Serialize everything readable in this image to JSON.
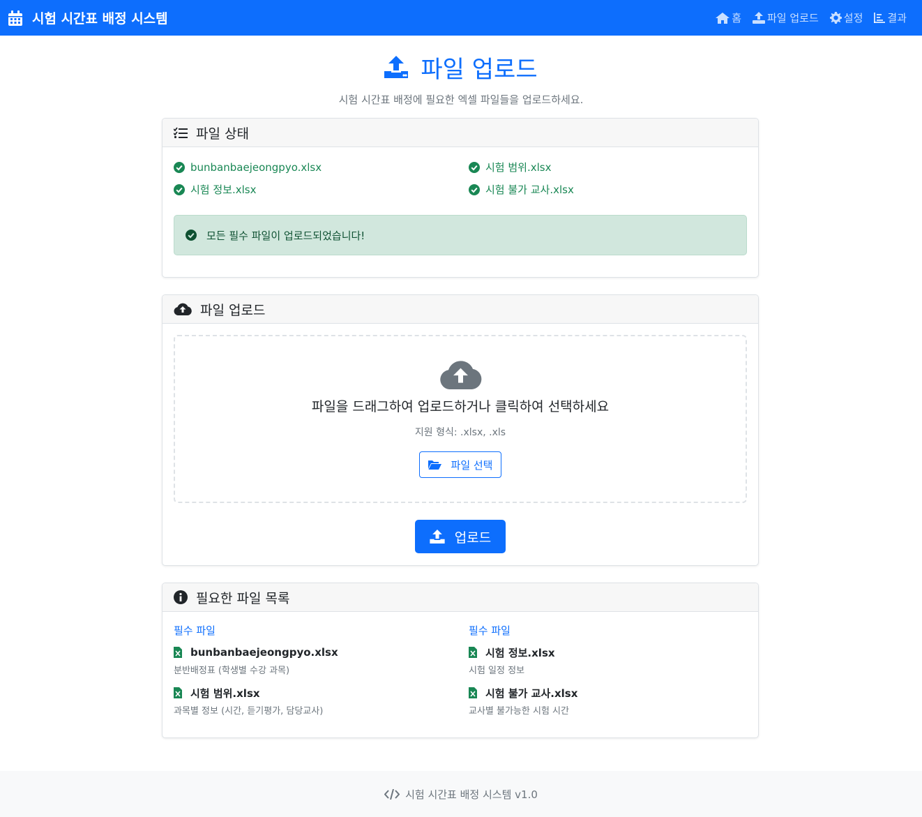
{
  "navbar": {
    "brand": "시험 시간표 배정 시스템",
    "links": [
      {
        "label": "홈",
        "icon": "home-icon"
      },
      {
        "label": "파일 업로드",
        "icon": "upload-icon"
      },
      {
        "label": "설정",
        "icon": "gear-icon"
      },
      {
        "label": "결과",
        "icon": "chart-icon"
      }
    ]
  },
  "header": {
    "title": "파일 업로드",
    "subtitle": "시험 시간표 배정에 필요한 엑셀 파일들을 업로드하세요."
  },
  "status_card": {
    "title": "파일 상태",
    "files": [
      "bunbanbaejeongpyo.xlsx",
      "시험 범위.xlsx",
      "시험 정보.xlsx",
      "시험 불가 교사.xlsx"
    ],
    "alert": "모든 필수 파일이 업로드되었습니다!"
  },
  "upload_card": {
    "title": "파일 업로드",
    "drop_text": "파일을 드래그하여 업로드하거나 클릭하여 선택하세요",
    "formats": "지원 형식: .xlsx, .xls",
    "select_button": "파일 선택",
    "upload_button": "업로드"
  },
  "required_card": {
    "title": "필요한 파일 목록",
    "columns": [
      {
        "heading": "필수 파일",
        "files": [
          {
            "name": "bunbanbaejeongpyo.xlsx",
            "desc": "분반배정표 (학생별 수강 과목)"
          },
          {
            "name": "시험 범위.xlsx",
            "desc": "과목별 정보 (시간, 듣기평가, 담당교사)"
          }
        ]
      },
      {
        "heading": "필수 파일",
        "files": [
          {
            "name": "시험 정보.xlsx",
            "desc": "시험 일정 정보"
          },
          {
            "name": "시험 불가 교사.xlsx",
            "desc": "교사별 불가능한 시험 시간"
          }
        ]
      }
    ]
  },
  "footer": {
    "text": "시험 시간표 배정 시스템 v1.0"
  },
  "colors": {
    "primary": "#0d6efd",
    "success": "#198754",
    "alert_bg": "#d1e7dd",
    "excel_green": "#198754"
  }
}
